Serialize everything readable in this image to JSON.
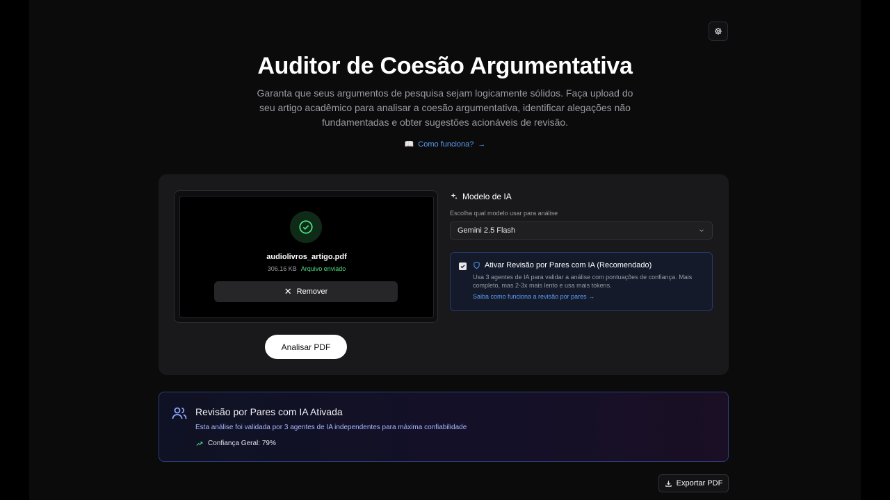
{
  "header": {
    "title": "Auditor de Coesão Argumentativa",
    "subtitle": "Garanta que seus argumentos de pesquisa sejam logicamente sólidos. Faça upload do seu artigo acadêmico para analisar a coesão argumentativa, identificar alegações não fundamentadas e obter sugestões acionáveis de revisão.",
    "how_it_works": "Como funciona?",
    "how_icon": "📖",
    "arrow": "→"
  },
  "upload": {
    "file_name": "audiolivros_artigo.pdf",
    "file_size": "306.16 KB",
    "status": "Arquivo enviado",
    "remove_label": "Remover",
    "analyze_label": "Analisar PDF"
  },
  "model": {
    "heading": "Modelo de IA",
    "help": "Escolha qual modelo usar para análise",
    "selected": "Gemini 2.5 Flash"
  },
  "peer_review": {
    "title": "Ativar Revisão por Pares com IA (Recomendado)",
    "description": "Usa 3 agentes de IA para validar a análise com pontuações de confiança. Mais completo, mas 2-3x mais lento e usa mais tokens.",
    "link": "Saiba como funciona a revisão por pares →",
    "checked": true
  },
  "active_panel": {
    "title": "Revisão por Pares com IA Ativada",
    "description": "Esta análise foi validada por 3 agentes de IA independentes para máxima confiabilidade",
    "confidence": "Confiança Geral: 79%"
  },
  "export": {
    "label": "Exportar PDF"
  },
  "colors": {
    "accent_blue": "#5b9cf5",
    "success_green": "#4ade80",
    "card_bg": "#19191b"
  },
  "icons": [
    "gear-icon",
    "book-icon",
    "check-circle-icon",
    "close-icon",
    "sparkles-icon",
    "chevron-down-icon",
    "checkbox-icon",
    "shield-icon",
    "users-icon",
    "trending-up-icon",
    "download-icon"
  ]
}
